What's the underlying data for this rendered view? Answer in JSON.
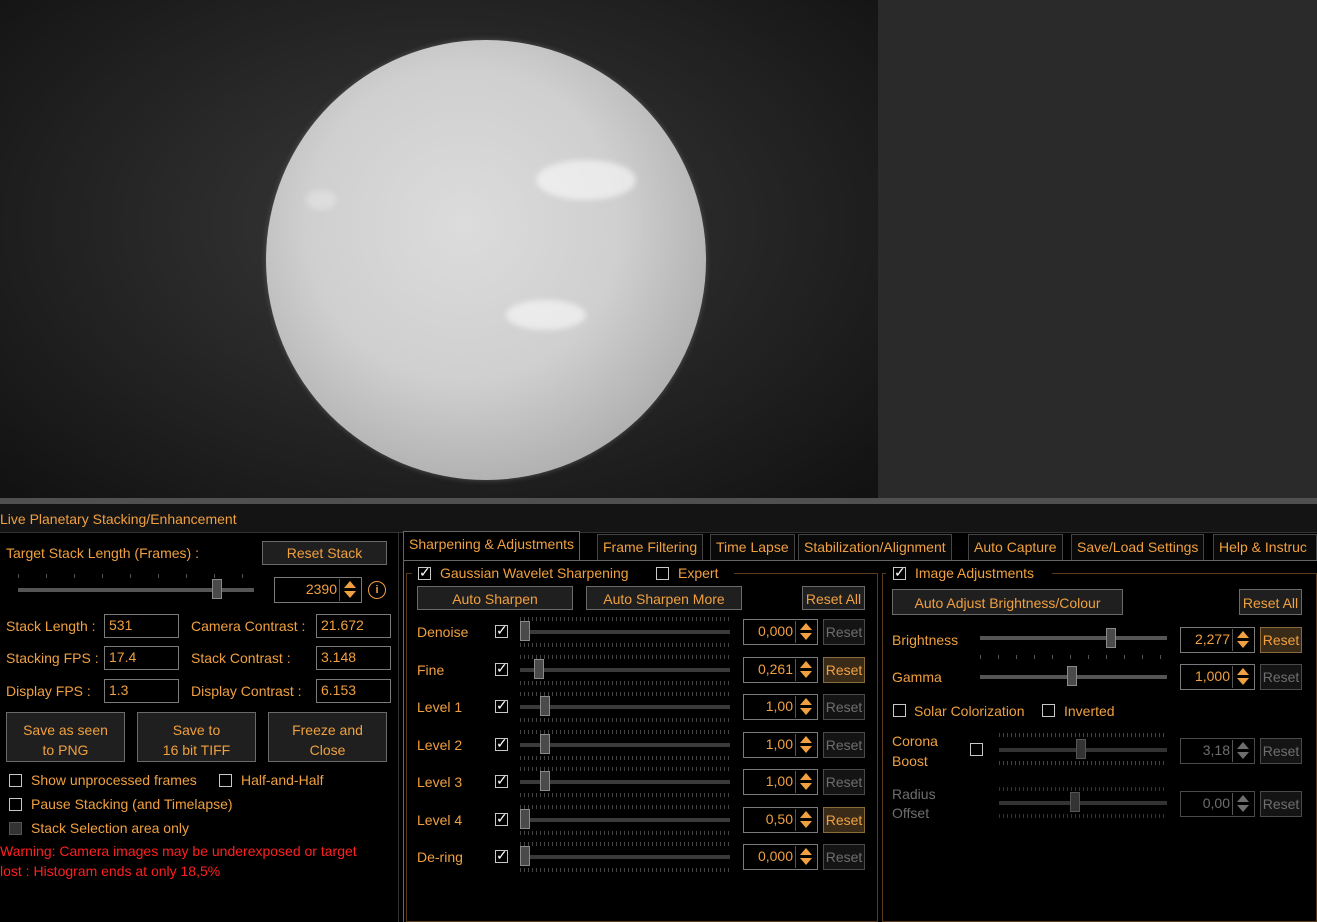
{
  "panel_title": "Live Planetary Stacking/Enhancement",
  "left": {
    "target_stack_label": "Target Stack Length (Frames) :",
    "reset_stack": "Reset Stack",
    "target_value": "2390",
    "target_slider": 0.86,
    "stats": {
      "stack_length_label": "Stack Length :",
      "stack_length": "531",
      "camera_contrast_label": "Camera Contrast :",
      "camera_contrast": "21.672",
      "stacking_fps_label": "Stacking FPS :",
      "stacking_fps": "17.4",
      "stack_contrast_label": "Stack Contrast :",
      "stack_contrast": "3.148",
      "display_fps_label": "Display FPS :",
      "display_fps": "1.3",
      "display_contrast_label": "Display Contrast :",
      "display_contrast": "6.153"
    },
    "buttons": {
      "save_png_1": "Save as seen",
      "save_png_2": "to PNG",
      "save_tiff_1": "Save to",
      "save_tiff_2": "16 bit TIFF",
      "freeze_1": "Freeze and",
      "freeze_2": "Close"
    },
    "options": {
      "show_unprocessed": "Show unprocessed frames",
      "half_and_half": "Half-and-Half",
      "pause_stacking": "Pause Stacking (and Timelapse)",
      "stack_selection": "Stack Selection area only"
    },
    "warning_1": "Warning: Camera images may be underexposed or target",
    "warning_2": "lost : Histogram ends at only 18,5%"
  },
  "tabs": [
    "Sharpening & Adjustments",
    "Frame Filtering",
    "Time Lapse",
    "Stabilization/Alignment",
    "Auto Capture",
    "Save/Load Settings",
    "Help & Instruc"
  ],
  "sharpening": {
    "group_label": "Gaussian Wavelet Sharpening",
    "expert_label": "Expert",
    "auto_sharpen": "Auto Sharpen",
    "auto_sharpen_more": "Auto Sharpen More",
    "reset_all": "Reset All",
    "reset_label": "Reset",
    "rows": [
      {
        "label": "Denoise",
        "value": "0,000",
        "level": 0.0
      },
      {
        "label": "Fine",
        "value": "0,261",
        "level": 0.07
      },
      {
        "label": "Level 1",
        "value": "1,00",
        "level": 0.1
      },
      {
        "label": "Level 2",
        "value": "1,00",
        "level": 0.1
      },
      {
        "label": "Level 3",
        "value": "1,00",
        "level": 0.1
      },
      {
        "label": "Level 4",
        "value": "0,50",
        "level": 0.0
      },
      {
        "label": "De-ring",
        "value": "0,000",
        "level": 0.0
      }
    ]
  },
  "image_adj": {
    "group_label": "Image Adjustments",
    "auto_adjust": "Auto Adjust Brightness/Colour",
    "reset_all": "Reset All",
    "reset_label": "Reset",
    "brightness_label": "Brightness",
    "brightness": "2,277",
    "brightness_level": 0.71,
    "gamma_label": "Gamma",
    "gamma": "1,000",
    "gamma_level": 0.49,
    "solar_colorization": "Solar Colorization",
    "inverted": "Inverted",
    "corona_1": "Corona",
    "corona_2": "Boost",
    "corona": "3,18",
    "corona_level": 0.49,
    "radius_1": "Radius",
    "radius_2": "Offset",
    "radius": "0,00",
    "radius_level": 0.45
  }
}
